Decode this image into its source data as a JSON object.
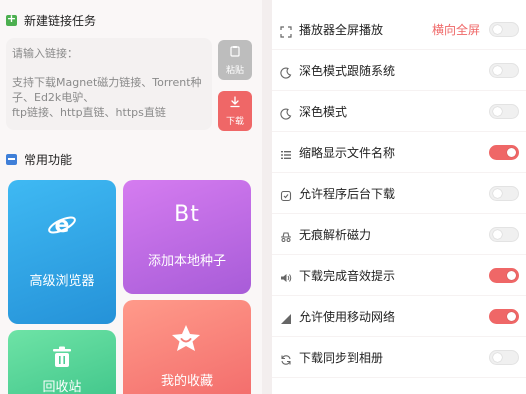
{
  "left": {
    "new_task": {
      "title": "新建链接任务"
    },
    "link_input": {
      "placeholder": "请输入链接：",
      "hint_lines": [
        "支持下载Magnet磁力链接、Torrent种",
        "子、Ed2k电驴、",
        "ftp链接、http直链、https直链"
      ]
    },
    "paste_button": {
      "label": "粘贴",
      "icon": "clipboard-icon"
    },
    "download_button": {
      "label": "下载",
      "icon": "download-icon"
    },
    "common": {
      "title": "常用功能"
    },
    "cards": {
      "browser": {
        "label": "高级浏览器",
        "icon": "browser-e-icon"
      },
      "torrent": {
        "label": "添加本地种子",
        "icon_text": "Bt"
      },
      "recycle": {
        "label": "回收站",
        "icon": "trash-icon"
      },
      "favorites": {
        "label": "我的收藏",
        "icon": "star-icon"
      }
    }
  },
  "settings": [
    {
      "label": "播放器全屏播放",
      "extra": "横向全屏",
      "on": false,
      "icon": "fullscreen-icon"
    },
    {
      "label": "深色模式跟随系统",
      "on": false,
      "icon": "moon-icon"
    },
    {
      "label": "深色模式",
      "on": false,
      "icon": "moon-icon"
    },
    {
      "label": "缩略显示文件名称",
      "on": true,
      "icon": "list-icon"
    },
    {
      "label": "允许程序后台下载",
      "on": false,
      "icon": "background-icon"
    },
    {
      "label": "无痕解析磁力",
      "on": false,
      "icon": "incognito-icon"
    },
    {
      "label": "下载完成音效提示",
      "on": true,
      "icon": "sound-icon"
    },
    {
      "label": "允许使用移动网络",
      "on": true,
      "icon": "signal-icon"
    },
    {
      "label": "下载同步到相册",
      "on": false,
      "icon": "sync-icon"
    }
  ],
  "colors": {
    "accent": "#ef6767"
  }
}
